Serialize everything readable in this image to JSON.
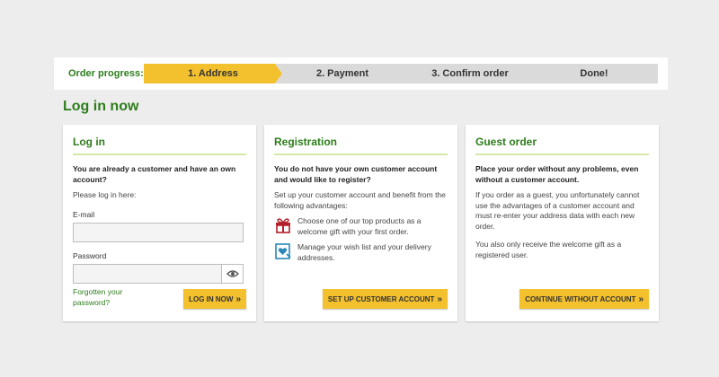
{
  "progress": {
    "label": "Order progress:",
    "steps": [
      {
        "label": "1. Address"
      },
      {
        "label": "2. Payment"
      },
      {
        "label": "3. Confirm order"
      },
      {
        "label": "Done!"
      }
    ]
  },
  "page_title": "Log in now",
  "login": {
    "title": "Log in",
    "lead": "You are already a customer and have an own account?",
    "hint": "Please log in here:",
    "email_label": "E-mail",
    "email_value": "",
    "password_label": "Password",
    "password_value": "",
    "forgot_link": "Forgotten your password?",
    "button": "LOG IN NOW"
  },
  "registration": {
    "title": "Registration",
    "lead": "You do not have your own customer account and would like to register?",
    "intro": "Set up your customer account and benefit from the following advantages:",
    "advantages": [
      {
        "icon": "gift-icon",
        "text": "Choose one of our top products as a welcome gift with your first order."
      },
      {
        "icon": "wishlist-icon",
        "text": "Manage your wish list and your delivery addresses."
      }
    ],
    "button": "SET UP CUSTOMER ACCOUNT"
  },
  "guest": {
    "title": "Guest order",
    "lead": "Place your order without any problems, even without a customer account.",
    "text1": "If you order as a guest, you unfortunately cannot use the advantages of a customer account and must re-enter your address data with each new order.",
    "text2": "You also only receive the welcome gift as a registered user.",
    "button": "CONTINUE WITHOUT ACCOUNT"
  },
  "colors": {
    "accent_green": "#2e7d1c",
    "button_yellow": "#f3c12d",
    "step_inactive": "#dadada",
    "gift_red": "#b3202a",
    "wishlist_blue": "#2a87b8"
  }
}
